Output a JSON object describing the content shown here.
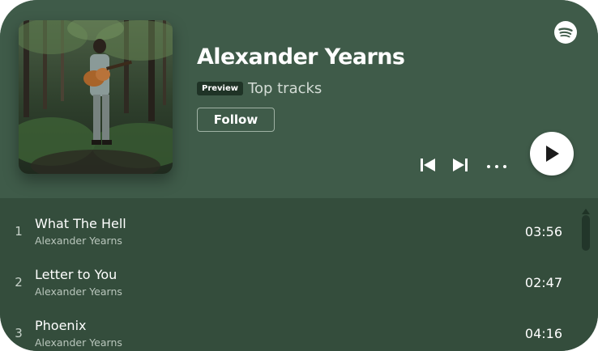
{
  "header": {
    "artist_name": "Alexander Yearns",
    "preview_badge": "Preview",
    "subtitle": "Top tracks",
    "follow_label": "Follow",
    "logo_icon": "spotify-logo-icon",
    "cover_image": "album-cover-musician-with-guitar-in-forest"
  },
  "controls": {
    "prev_icon": "skip-previous-icon",
    "next_icon": "skip-next-icon",
    "more_icon": "more-options-icon",
    "play_icon": "play-icon"
  },
  "tracks": [
    {
      "number": "1",
      "title": "What The Hell",
      "artist": "Alexander Yearns",
      "duration": "03:56"
    },
    {
      "number": "2",
      "title": "Letter to You",
      "artist": "Alexander Yearns",
      "duration": "02:47"
    },
    {
      "number": "3",
      "title": "Phoenix",
      "artist": "Alexander Yearns",
      "duration": "04:16"
    }
  ],
  "colors": {
    "header_bg": "#3f5b49",
    "tracklist_bg": "#344d3c",
    "accent": "#ffffff"
  }
}
